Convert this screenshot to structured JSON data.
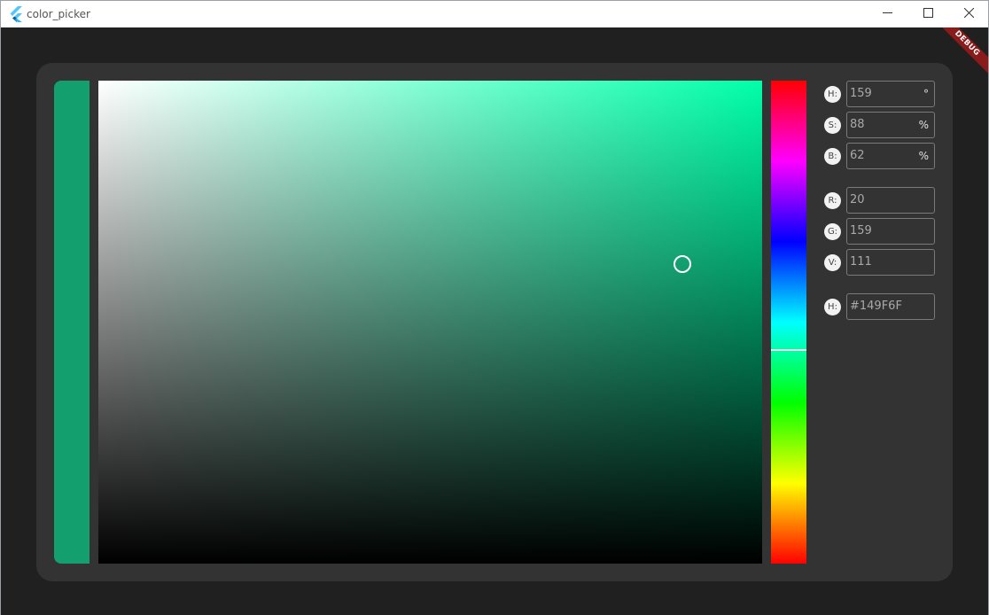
{
  "window": {
    "title": "color_picker",
    "debug_label": "DEBUG"
  },
  "colors": {
    "selected": "#149F6F",
    "hue_pure": "#00FFA9",
    "card_bg": "#333333",
    "window_bg": "#202020",
    "debug_ribbon": "#8B1A1A"
  },
  "picker": {
    "hue": 159,
    "saturation": 88,
    "brightness": 62
  },
  "fields": {
    "h": {
      "label": "H:",
      "value": "159",
      "unit": "°"
    },
    "s": {
      "label": "S:",
      "value": "88",
      "unit": "%"
    },
    "b": {
      "label": "B:",
      "value": "62",
      "unit": "%"
    },
    "r": {
      "label": "R:",
      "value": "20"
    },
    "g": {
      "label": "G:",
      "value": "159"
    },
    "v": {
      "label": "V:",
      "value": "111"
    },
    "hex": {
      "label": "H:",
      "value": "#149F6F"
    }
  },
  "icons": {
    "app": "flutter-logo-icon",
    "minimize": "minimize-icon",
    "maximize": "maximize-icon",
    "close": "close-icon"
  }
}
